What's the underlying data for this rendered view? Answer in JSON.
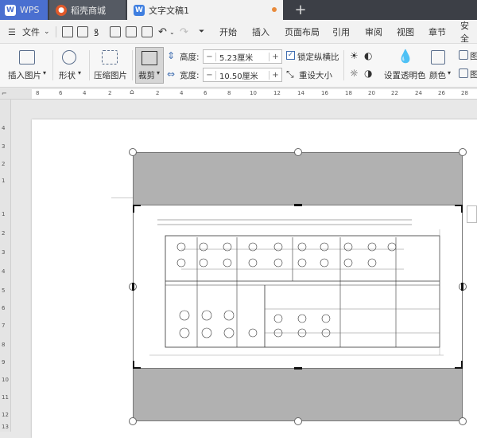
{
  "tabs": [
    {
      "label": "WPS"
    },
    {
      "label": "稻壳商城"
    },
    {
      "label": "文字文稿1"
    }
  ],
  "menu": {
    "file": "文件",
    "items": [
      "开始",
      "插入",
      "页面布局",
      "引用",
      "审阅",
      "视图",
      "章节",
      "安全"
    ]
  },
  "ribbon": {
    "insert_picture": "插入图片",
    "shape": "形状",
    "compress_picture": "压缩图片",
    "crop": "裁剪",
    "height_label": "高度:",
    "height_value": "5.23厘米",
    "width_label": "宽度:",
    "width_value": "10.50厘米",
    "lock_ratio": "锁定纵横比",
    "reset_size": "重设大小",
    "set_transparent": "设置透明色",
    "color": "颜色",
    "picture": "图"
  },
  "ruler": {
    "h_ticks": [
      "8",
      "6",
      "4",
      "2",
      "2",
      "4",
      "6",
      "8",
      "10",
      "12",
      "14",
      "16",
      "18",
      "20",
      "22",
      "24",
      "26",
      "28"
    ],
    "v_ticks": [
      "4",
      "3",
      "2",
      "1",
      "1",
      "2",
      "3",
      "4",
      "5",
      "6",
      "7",
      "8",
      "9",
      "10",
      "11",
      "12",
      "13"
    ]
  },
  "colors": {
    "wps_blue": "#4a6fd0",
    "titlebar": "#3c3f46",
    "crop_grey": "#b1b1b1"
  },
  "icons": [
    "wps-logo-icon",
    "store-icon",
    "doc-icon",
    "new-tab-icon",
    "menu-icon",
    "chevron-down-icon",
    "open-folder-icon",
    "save-icon",
    "format-painter-icon",
    "print-icon",
    "print-preview-icon",
    "export-icon",
    "undo-icon",
    "redo-icon",
    "more-icon",
    "insert-picture-icon",
    "shape-icon",
    "compress-picture-icon",
    "crop-icon",
    "height-icon",
    "width-icon",
    "checkbox-icon",
    "reset-size-icon",
    "transparent-icon",
    "color-icon",
    "picture-icon"
  ]
}
